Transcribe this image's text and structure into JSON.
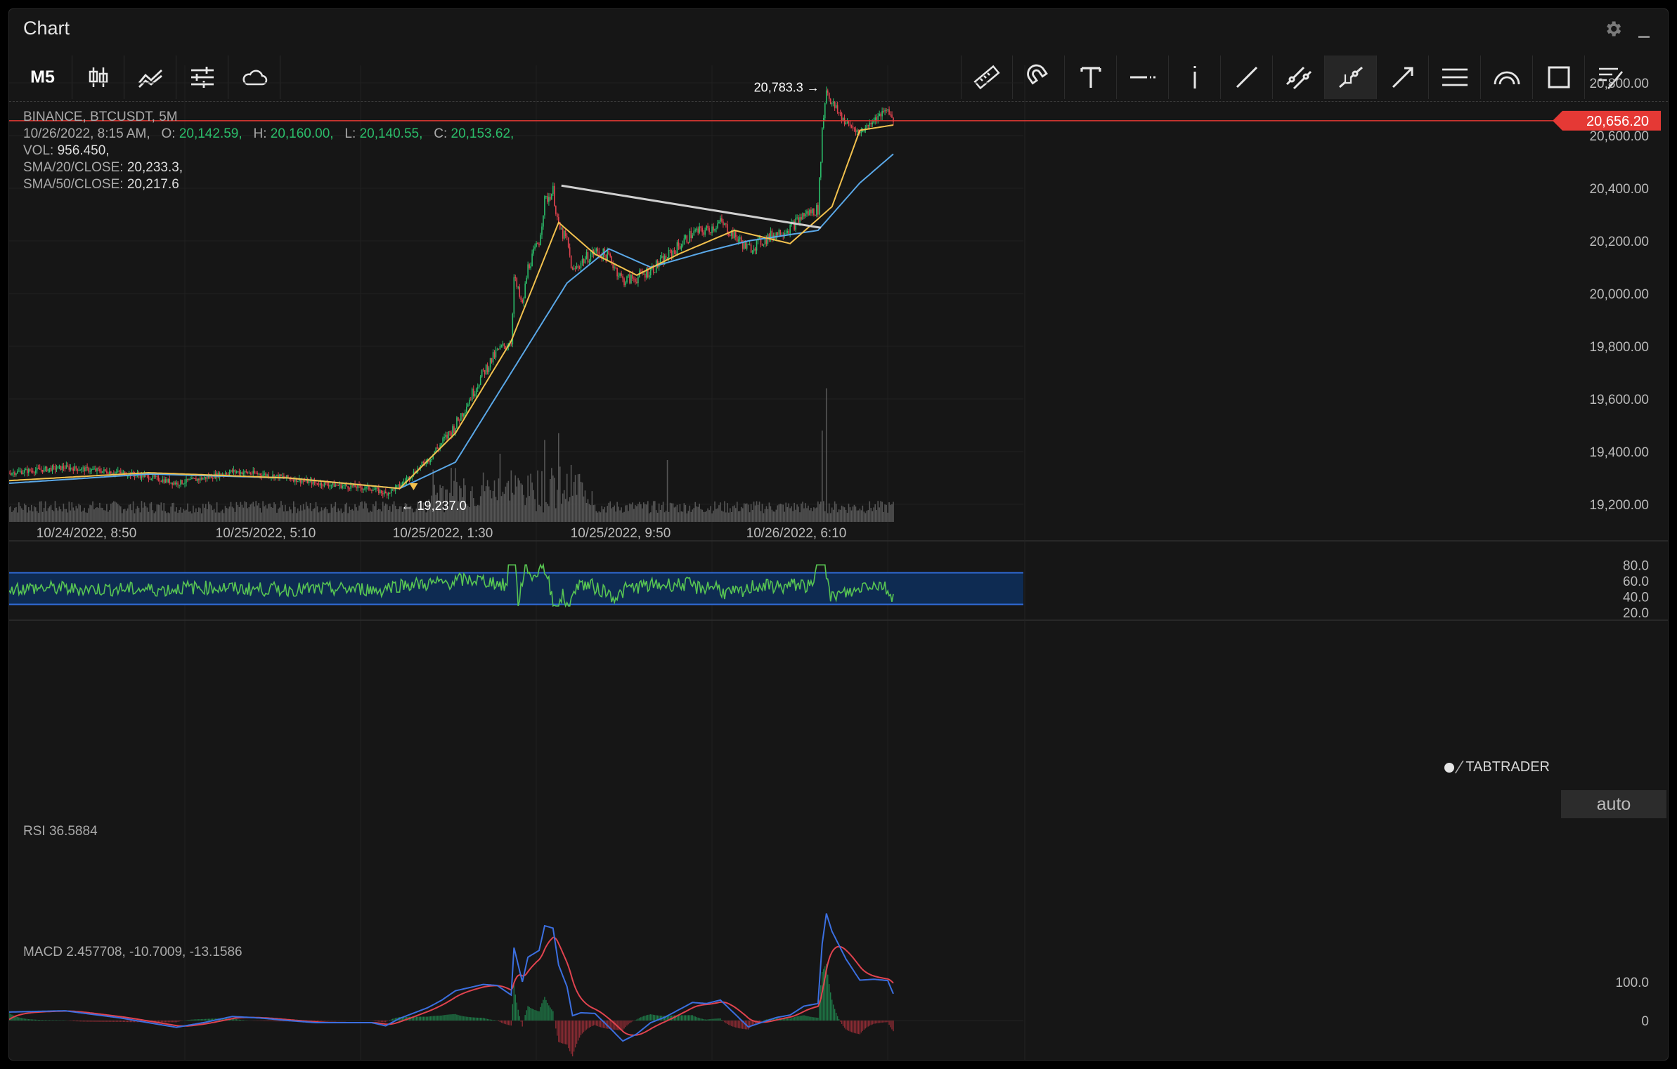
{
  "window": {
    "title": "Chart"
  },
  "toolbar": {
    "timeframe": "M5",
    "left_tools": [
      {
        "name": "candlestick-icon"
      },
      {
        "name": "indicators-icon"
      },
      {
        "name": "settings-sliders-icon"
      },
      {
        "name": "cloud-icon"
      }
    ],
    "drawing_tools": [
      {
        "name": "ruler-icon"
      },
      {
        "name": "magnet-icon"
      },
      {
        "name": "text-icon"
      },
      {
        "name": "horizontal-line-icon"
      },
      {
        "name": "vertical-line-icon"
      },
      {
        "name": "trend-line-icon"
      },
      {
        "name": "parallel-channel-icon"
      },
      {
        "name": "ray-icon",
        "active": true
      },
      {
        "name": "arrow-line-icon"
      },
      {
        "name": "fib-retracement-icon"
      },
      {
        "name": "arc-icon"
      },
      {
        "name": "rectangle-icon"
      },
      {
        "name": "drawings-list-icon"
      }
    ]
  },
  "info": {
    "symbol": "BINANCE, BTCUSDT, 5M",
    "datetime": "10/26/2022, 8:15 AM,",
    "open_label": "O:",
    "open": "20,142.59,",
    "high_label": "H:",
    "high": "20,160.00,",
    "low_label": "L:",
    "low": "20,140.55,",
    "close_label": "C:",
    "close": "20,153.62,",
    "vol_label": "VOL:",
    "vol": "956.450,",
    "sma20_label": "SMA/20/CLOSE:",
    "sma20": "20,233.3,",
    "sma50_label": "SMA/50/CLOSE:",
    "sma50": "20,217.6"
  },
  "price_axis": {
    "ticks": [
      "20,800.00",
      "20,600.00",
      "20,400.00",
      "20,200.00",
      "20,000.00",
      "19,800.00",
      "19,600.00",
      "19,400.00",
      "19,200.00"
    ]
  },
  "time_axis": {
    "ticks": [
      "10/24/2022, 8:50",
      "10/25/2022, 5:10",
      "10/25/2022, 1:30",
      "10/25/2022, 9:50",
      "10/26/2022, 6:10"
    ]
  },
  "current_price": "20,656.20",
  "high_marker": "20,783.3 →",
  "low_marker": "← 19,237.0",
  "brand": "TABTRADER",
  "auto_button": "auto",
  "rsi": {
    "label": "RSI 36.5884",
    "ticks": [
      "80.0",
      "60.0",
      "40.0",
      "20.0"
    ]
  },
  "macd": {
    "label": "MACD 2.457708, -10.7009, -13.1586",
    "ticks": [
      "100.0",
      "0"
    ]
  },
  "colors": {
    "up": "#2bbd6a",
    "down": "#e0434f",
    "sma20": "#f2c14e",
    "sma50": "#5aa8e8",
    "price_line": "#e53935",
    "rsi_band": "#0e2b52",
    "rsi_line": "#58c552",
    "macd_line": "#3b6fe0",
    "signal_line": "#e0434f"
  },
  "chart_data": {
    "type": "candlestick",
    "x_axis_ticks": [
      "10/24/2022, 8:50",
      "10/25/2022, 5:10",
      "10/25/2022, 1:30",
      "10/25/2022, 9:50",
      "10/26/2022, 6:10"
    ],
    "ylim": [
      19120,
      20900
    ],
    "close_path": [
      [
        0,
        19320
      ],
      [
        20,
        19330
      ],
      [
        40,
        19340
      ],
      [
        60,
        19330
      ],
      [
        80,
        19320
      ],
      [
        100,
        19305
      ],
      [
        120,
        19280
      ],
      [
        140,
        19300
      ],
      [
        160,
        19325
      ],
      [
        180,
        19315
      ],
      [
        200,
        19300
      ],
      [
        220,
        19280
      ],
      [
        240,
        19270
      ],
      [
        260,
        19260
      ],
      [
        270,
        19240
      ],
      [
        280,
        19270
      ],
      [
        290,
        19320
      ],
      [
        300,
        19370
      ],
      [
        310,
        19430
      ],
      [
        320,
        19500
      ],
      [
        330,
        19600
      ],
      [
        340,
        19700
      ],
      [
        350,
        19780
      ],
      [
        360,
        19820
      ],
      [
        362,
        20060
      ],
      [
        368,
        19950
      ],
      [
        372,
        20100
      ],
      [
        380,
        20200
      ],
      [
        384,
        20350
      ],
      [
        390,
        20390
      ],
      [
        394,
        20250
      ],
      [
        400,
        20200
      ],
      [
        404,
        20080
      ],
      [
        410,
        20120
      ],
      [
        420,
        20160
      ],
      [
        430,
        20140
      ],
      [
        440,
        20050
      ],
      [
        450,
        20060
      ],
      [
        460,
        20090
      ],
      [
        470,
        20130
      ],
      [
        480,
        20180
      ],
      [
        490,
        20230
      ],
      [
        500,
        20240
      ],
      [
        510,
        20270
      ],
      [
        520,
        20220
      ],
      [
        530,
        20170
      ],
      [
        540,
        20200
      ],
      [
        550,
        20230
      ],
      [
        560,
        20250
      ],
      [
        570,
        20300
      ],
      [
        580,
        20320
      ],
      [
        583,
        20620
      ],
      [
        586,
        20780
      ],
      [
        590,
        20720
      ],
      [
        600,
        20650
      ],
      [
        610,
        20610
      ],
      [
        620,
        20660
      ],
      [
        630,
        20700
      ],
      [
        634,
        20656
      ]
    ],
    "sma20_path": [
      [
        0,
        19290
      ],
      [
        100,
        19320
      ],
      [
        200,
        19300
      ],
      [
        280,
        19260
      ],
      [
        320,
        19470
      ],
      [
        360,
        19820
      ],
      [
        394,
        20270
      ],
      [
        420,
        20150
      ],
      [
        450,
        20070
      ],
      [
        480,
        20150
      ],
      [
        520,
        20240
      ],
      [
        560,
        20190
      ],
      [
        590,
        20330
      ],
      [
        610,
        20620
      ],
      [
        634,
        20640
      ]
    ],
    "sma50_path": [
      [
        0,
        19280
      ],
      [
        100,
        19315
      ],
      [
        200,
        19300
      ],
      [
        280,
        19260
      ],
      [
        320,
        19360
      ],
      [
        360,
        19700
      ],
      [
        400,
        20040
      ],
      [
        430,
        20170
      ],
      [
        460,
        20100
      ],
      [
        500,
        20160
      ],
      [
        530,
        20200
      ],
      [
        580,
        20240
      ],
      [
        610,
        20420
      ],
      [
        634,
        20530
      ]
    ],
    "trend_line": [
      [
        396,
        20410
      ],
      [
        582,
        20250
      ]
    ],
    "current_price": 20656.2,
    "high": 20783.3,
    "low": 19237.0,
    "last_candle": {
      "time": "10/26/2022, 8:15 AM",
      "open": 20142.59,
      "high": 20160.0,
      "low": 20140.55,
      "close": 20153.62,
      "volume": 956.45
    },
    "sma20_last": 20233.3,
    "sma50_last": 20217.6,
    "rsi_last": 36.5884,
    "rsi_band": [
      30,
      70
    ],
    "rsi_ylim": [
      10,
      90
    ],
    "macd_values": [
      2.457708,
      -10.7009,
      -13.1586
    ]
  }
}
